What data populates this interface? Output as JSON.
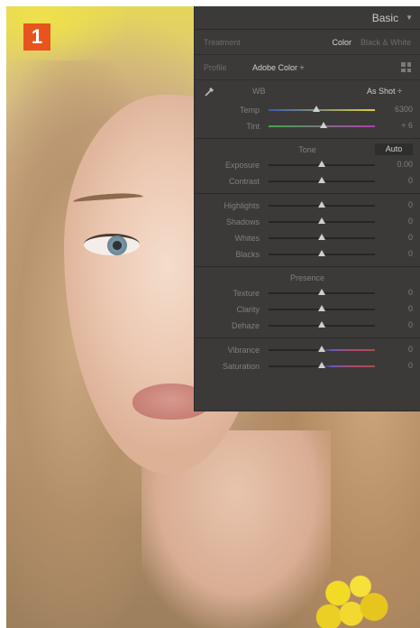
{
  "badge": "1",
  "panel": {
    "title": "Basic",
    "treatment": {
      "label": "Treatment",
      "color": "Color",
      "bw": "Black & White"
    },
    "profile": {
      "label": "Profile",
      "value": "Adobe Color ÷"
    },
    "wb": {
      "label": "WB",
      "value": "As Shot ÷"
    },
    "temp": {
      "label": "Temp",
      "value": "6300",
      "position": 0.45
    },
    "tint": {
      "label": "Tint",
      "value": "+ 6",
      "position": 0.52
    },
    "tone": {
      "label": "Tone",
      "auto": "Auto"
    },
    "tone_sliders": [
      {
        "label": "Exposure",
        "value": "0.00",
        "position": 0.5
      },
      {
        "label": "Contrast",
        "value": "0",
        "position": 0.5
      }
    ],
    "light_sliders": [
      {
        "label": "Highlights",
        "value": "0",
        "position": 0.5
      },
      {
        "label": "Shadows",
        "value": "0",
        "position": 0.5
      },
      {
        "label": "Whites",
        "value": "0",
        "position": 0.5
      },
      {
        "label": "Blacks",
        "value": "0",
        "position": 0.5
      }
    ],
    "presence": {
      "label": "Presence"
    },
    "presence_sliders": [
      {
        "label": "Texture",
        "value": "0",
        "position": 0.5
      },
      {
        "label": "Clarity",
        "value": "0",
        "position": 0.5
      },
      {
        "label": "Dehaze",
        "value": "0",
        "position": 0.5
      }
    ],
    "color_sliders": [
      {
        "label": "Vibrance",
        "value": "0",
        "position": 0.5
      },
      {
        "label": "Saturation",
        "value": "0",
        "position": 0.5
      }
    ]
  }
}
